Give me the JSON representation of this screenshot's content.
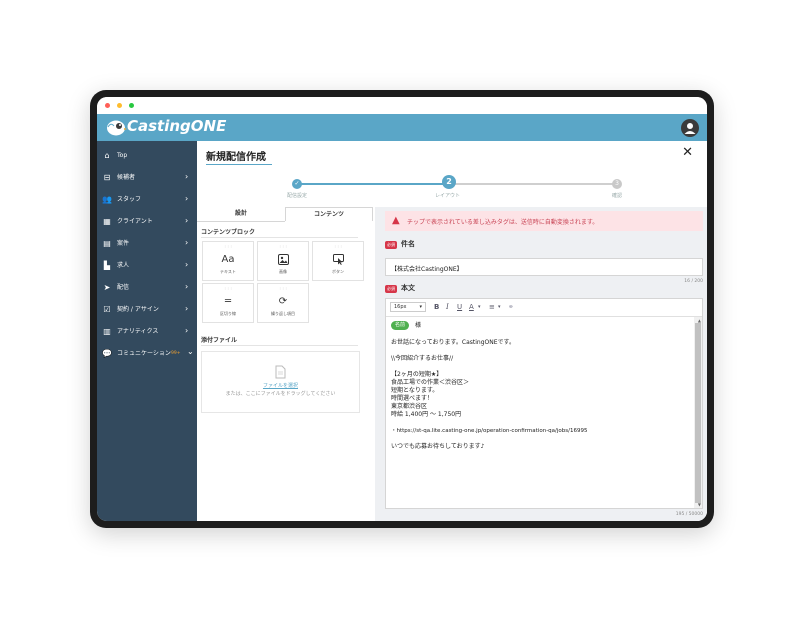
{
  "app": {
    "name": "CastingONE"
  },
  "colors": {
    "accent": "#5aa6c7",
    "sidebar": "#334a5e",
    "required": "#d63649"
  },
  "sidebar": {
    "items": [
      {
        "icon": "home-icon",
        "label": "Top",
        "has_chevron": false
      },
      {
        "icon": "candidate-icon",
        "label": "候補者",
        "has_chevron": true
      },
      {
        "icon": "staff-icon",
        "label": "スタッフ",
        "has_chevron": true
      },
      {
        "icon": "client-icon",
        "label": "クライアント",
        "has_chevron": true
      },
      {
        "icon": "case-icon",
        "label": "案件",
        "has_chevron": true
      },
      {
        "icon": "job-icon",
        "label": "求人",
        "has_chevron": true
      },
      {
        "icon": "send-icon",
        "label": "配信",
        "has_chevron": true
      },
      {
        "icon": "contract-icon",
        "label": "契約 / アサイン",
        "has_chevron": true
      },
      {
        "icon": "analytics-icon",
        "label": "アナリティクス",
        "has_chevron": true
      },
      {
        "icon": "chat-icon",
        "label": "コミュニケーション",
        "badge": "99+",
        "has_chevron": true
      }
    ]
  },
  "main": {
    "title": "新規配信作成",
    "steps": [
      {
        "number": "1",
        "label": "配信設定",
        "state": "done",
        "mark": "✓"
      },
      {
        "number": "2",
        "label": "レイアウト",
        "state": "current"
      },
      {
        "number": "3",
        "label": "確認",
        "state": "todo"
      }
    ],
    "tabs": [
      {
        "label": "設計",
        "active": false
      },
      {
        "label": "コンテンツ",
        "active": true
      }
    ],
    "content_blocks_title": "コンテンツブロック",
    "blocks": [
      {
        "icon": "text-icon",
        "glyph": "Aa",
        "label": "テキスト"
      },
      {
        "icon": "image-icon",
        "glyph": "🖼",
        "label": "画像"
      },
      {
        "icon": "button-icon",
        "glyph": "▣",
        "label": "ボタン"
      },
      {
        "icon": "divider-icon",
        "glyph": "═",
        "label": "区切り線"
      },
      {
        "icon": "repeat-icon",
        "glyph": "⟳",
        "label": "繰り返し項目"
      }
    ],
    "attachments": {
      "title": "添付ファイル",
      "select_link": "ファイルを選択",
      "drop_hint": "または、ここにファイルをドラッグしてください"
    }
  },
  "alert": {
    "text": "チップで表示されている差し込みタグは、送信時に自動変換されます。"
  },
  "subject": {
    "required_badge": "必須",
    "label": "件名",
    "value": "【株式会社CastingONE】",
    "counter": "16 / 200"
  },
  "body": {
    "required_badge": "必須",
    "label": "本文",
    "font_size": "16px",
    "chip": "名前",
    "chip_suffix": "様",
    "lines": [
      "お世話になっております。CastingONEです。",
      "",
      "\\\\今回紹介するお仕事//",
      "",
      "【2ヶ月の短期★】",
      "食品工場での作業＜渋谷区＞",
      "短期となります。",
      "時間選べます！",
      "東京都渋谷区",
      "時給 1,400円 ～ 1,750円",
      "",
      "・https://st-qa.lite.casting-one.jp/operation-confirmation-qa/jobs/16995",
      "",
      "いつでも応募お待ちしております♪"
    ],
    "counter": "195 / 50000"
  }
}
